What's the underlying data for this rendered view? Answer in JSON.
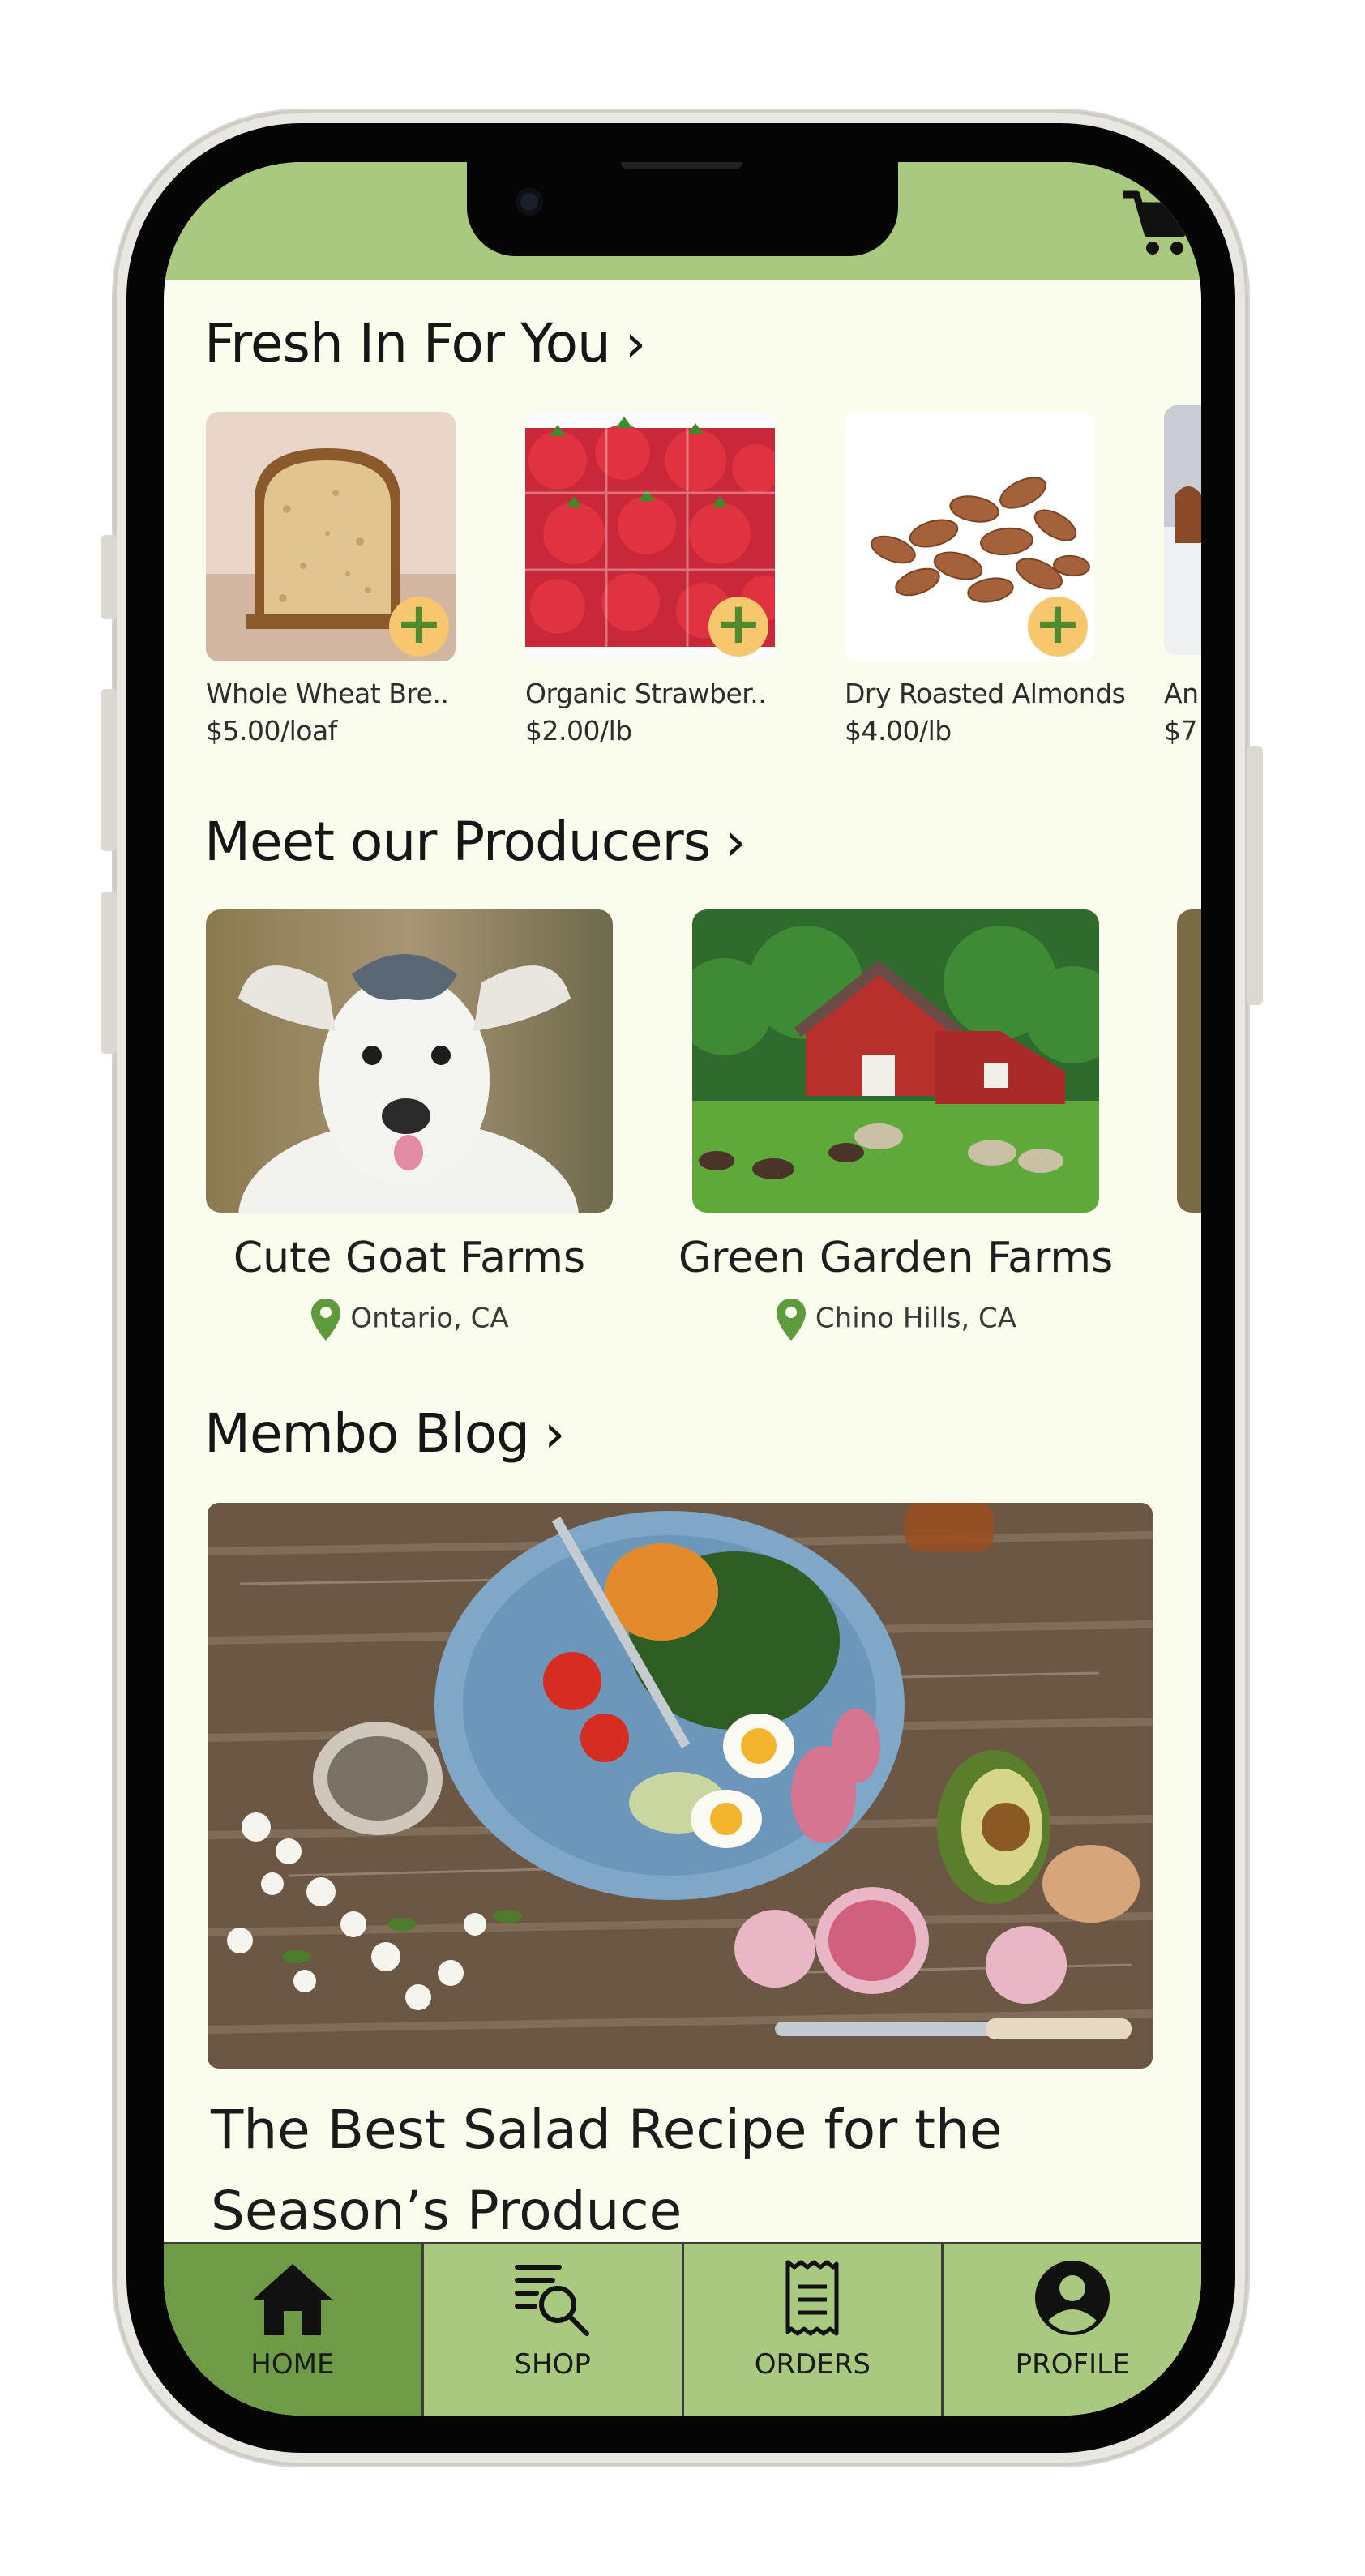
{
  "fresh": {
    "title": "Fresh In For You",
    "chevron": "›",
    "add_label": "+",
    "items": [
      {
        "name": "Whole Wheat Bre..",
        "price": "$5.00/loaf",
        "icon": "bread-image"
      },
      {
        "name": "Organic Strawber..",
        "price": "$2.00/lb",
        "icon": "strawberries-image"
      },
      {
        "name": "Dry Roasted Almonds",
        "price": "$4.00/lb",
        "icon": "almonds-image"
      },
      {
        "name": "An",
        "price": "$7",
        "icon": "partial-product-image"
      }
    ]
  },
  "producers": {
    "title": "Meet our Producers",
    "chevron": "›",
    "items": [
      {
        "name": "Cute Goat Farms",
        "location": "Ontario, CA",
        "icon": "goat-image"
      },
      {
        "name": "Green Garden Farms",
        "location": "Chino Hills, CA",
        "icon": "barn-image"
      }
    ]
  },
  "blog": {
    "title": "Membo Blog",
    "chevron": "›",
    "post_title_line1": "The Best Salad Recipe for the",
    "post_title_line2": "Season’s Produce",
    "icon": "salad-image"
  },
  "tabs": [
    {
      "label": "HOME",
      "icon": "home-icon",
      "active": true
    },
    {
      "label": "SHOP",
      "icon": "shop-search-icon",
      "active": false
    },
    {
      "label": "ORDERS",
      "icon": "receipt-icon",
      "active": false
    },
    {
      "label": "PROFILE",
      "icon": "profile-icon",
      "active": false
    }
  ],
  "colors": {
    "accent_green": "#a8c97e",
    "active_tab": "#6f9a46",
    "background": "#fafdee",
    "add_button": "#f6c76d",
    "pin": "#5f9a3d"
  }
}
